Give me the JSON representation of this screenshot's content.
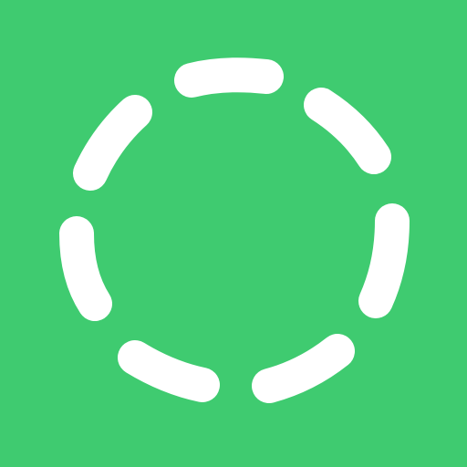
{
  "app_icon": {
    "name": "dashed-circle-logo",
    "background_color": "#3fcb70",
    "mark_color": "#ffffff",
    "segment_count": 7
  }
}
